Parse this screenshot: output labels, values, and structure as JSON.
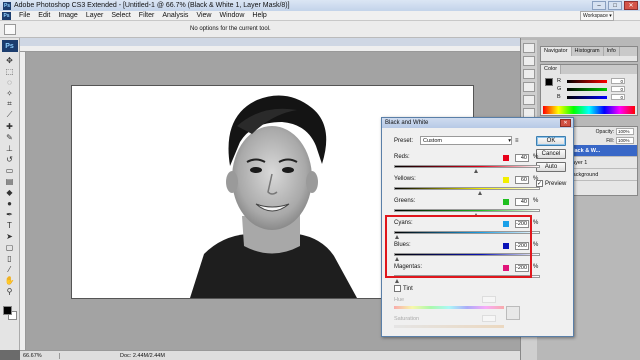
{
  "window": {
    "title": "Adobe Photoshop CS3 Extended - [Untitled-1 @ 66.7% (Black & White 1, Layer Mask/8)]",
    "app_badge": "Ps"
  },
  "menu": [
    "File",
    "Edit",
    "Image",
    "Layer",
    "Select",
    "Filter",
    "Analysis",
    "View",
    "Window",
    "Help"
  ],
  "workspace_label": "Workspace ▾",
  "options_bar": {
    "notice": "No options for the current tool."
  },
  "status": {
    "zoom": "66.67%",
    "doc_size": "Doc: 2.44M/2.44M"
  },
  "panels": {
    "navigator_tabs": [
      "Navigator",
      "Histogram",
      "Info"
    ],
    "color_tab": "Color",
    "color_rows": [
      {
        "label": "R",
        "value": "0"
      },
      {
        "label": "G",
        "value": "0"
      },
      {
        "label": "B",
        "value": "0"
      }
    ],
    "layers": {
      "opacity_label": "Opacity:",
      "opacity_value": "100%",
      "fill_label": "Fill:",
      "fill_value": "100%",
      "rows": [
        {
          "name": "Black & W...",
          "selected": true
        },
        {
          "name": "Layer 1",
          "selected": false
        },
        {
          "name": "Background",
          "selected": false
        }
      ]
    }
  },
  "dialog": {
    "title": "Black and White",
    "preset_label": "Preset:",
    "preset_value": "Custom",
    "buttons": {
      "ok": "OK",
      "cancel": "Cancel",
      "auto": "Auto"
    },
    "preview_label": "Preview",
    "sliders": [
      {
        "name": "Reds:",
        "value": "40",
        "color": "#e8001a",
        "pos": 0.56
      },
      {
        "name": "Yellows:",
        "value": "60",
        "color": "#f2ef00",
        "pos": 0.59
      },
      {
        "name": "Greens:",
        "value": "40",
        "color": "#1fbf1f",
        "pos": 0.56
      },
      {
        "name": "Cyans:",
        "value": "-200",
        "color": "#1aa0e8",
        "pos": 0.02
      },
      {
        "name": "Blues:",
        "value": "-200",
        "color": "#0a13b8",
        "pos": 0.02
      },
      {
        "name": "Magentas:",
        "value": "-200",
        "color": "#e0157a",
        "pos": 0.02
      }
    ],
    "tint_label": "Tint",
    "hue_label": "Hue",
    "saturation_label": "Saturation",
    "percent": "%"
  },
  "colors": {
    "highlight_box": "#e0171d",
    "layer_selected": "#3867c7"
  }
}
